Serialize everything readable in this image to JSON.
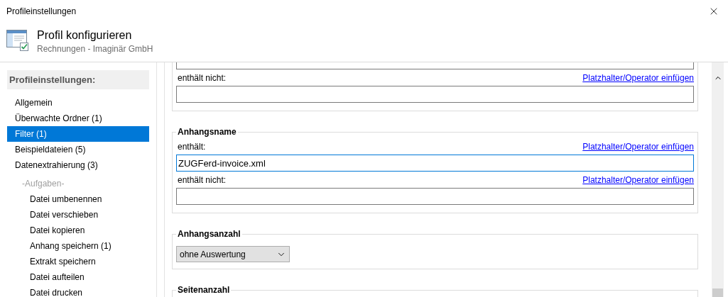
{
  "window": {
    "title": "Profileinstellungen"
  },
  "header": {
    "title": "Profil konfigurieren",
    "subtitle": "Rechnungen - Imaginär GmbH"
  },
  "sidebar": {
    "heading": "Profileinstellungen:",
    "items": [
      {
        "kind": "item",
        "label": "Allgemein",
        "selected": false
      },
      {
        "kind": "item",
        "label": "Überwachte Ordner (1)",
        "selected": false
      },
      {
        "kind": "item",
        "label": "Filter (1)",
        "selected": true
      },
      {
        "kind": "item",
        "label": "Beispieldateien (5)",
        "selected": false
      },
      {
        "kind": "item",
        "label": "Datenextrahierung (3)",
        "selected": false
      },
      {
        "kind": "section",
        "label": "-Aufgaben-"
      },
      {
        "kind": "subitem",
        "label": "Datei umbenennen",
        "selected": false
      },
      {
        "kind": "subitem",
        "label": "Datei verschieben",
        "selected": false
      },
      {
        "kind": "subitem",
        "label": "Datei kopieren",
        "selected": false
      },
      {
        "kind": "subitem",
        "label": "Anhang speichern (1)",
        "selected": false
      },
      {
        "kind": "subitem",
        "label": "Extrakt speichern",
        "selected": false
      },
      {
        "kind": "subitem",
        "label": "Datei aufteilen",
        "selected": false
      },
      {
        "kind": "subitem",
        "label": "Datei drucken",
        "selected": false
      }
    ]
  },
  "groups": [
    {
      "items": [
        {
          "kind": "input",
          "focused": false
        },
        {
          "kind": "label",
          "label": "enthält nicht:",
          "link": "Platzhalter/Operator einfügen"
        },
        {
          "kind": "input",
          "focused": false
        }
      ]
    },
    {
      "title": "Anhangsname",
      "items": [
        {
          "kind": "label",
          "label": "enthält:",
          "link": "Platzhalter/Operator einfügen"
        },
        {
          "kind": "input",
          "value": "ZUGFerd-invoice.xml",
          "focused": true
        },
        {
          "kind": "label",
          "label": "enthält nicht:",
          "link": "Platzhalter/Operator einfügen"
        },
        {
          "kind": "input",
          "focused": false
        }
      ]
    },
    {
      "title": "Anhangsanzahl",
      "items": [
        {
          "kind": "select",
          "value": "ohne Auswertung"
        }
      ]
    },
    {
      "title": "Seitenanzahl"
    }
  ]
}
